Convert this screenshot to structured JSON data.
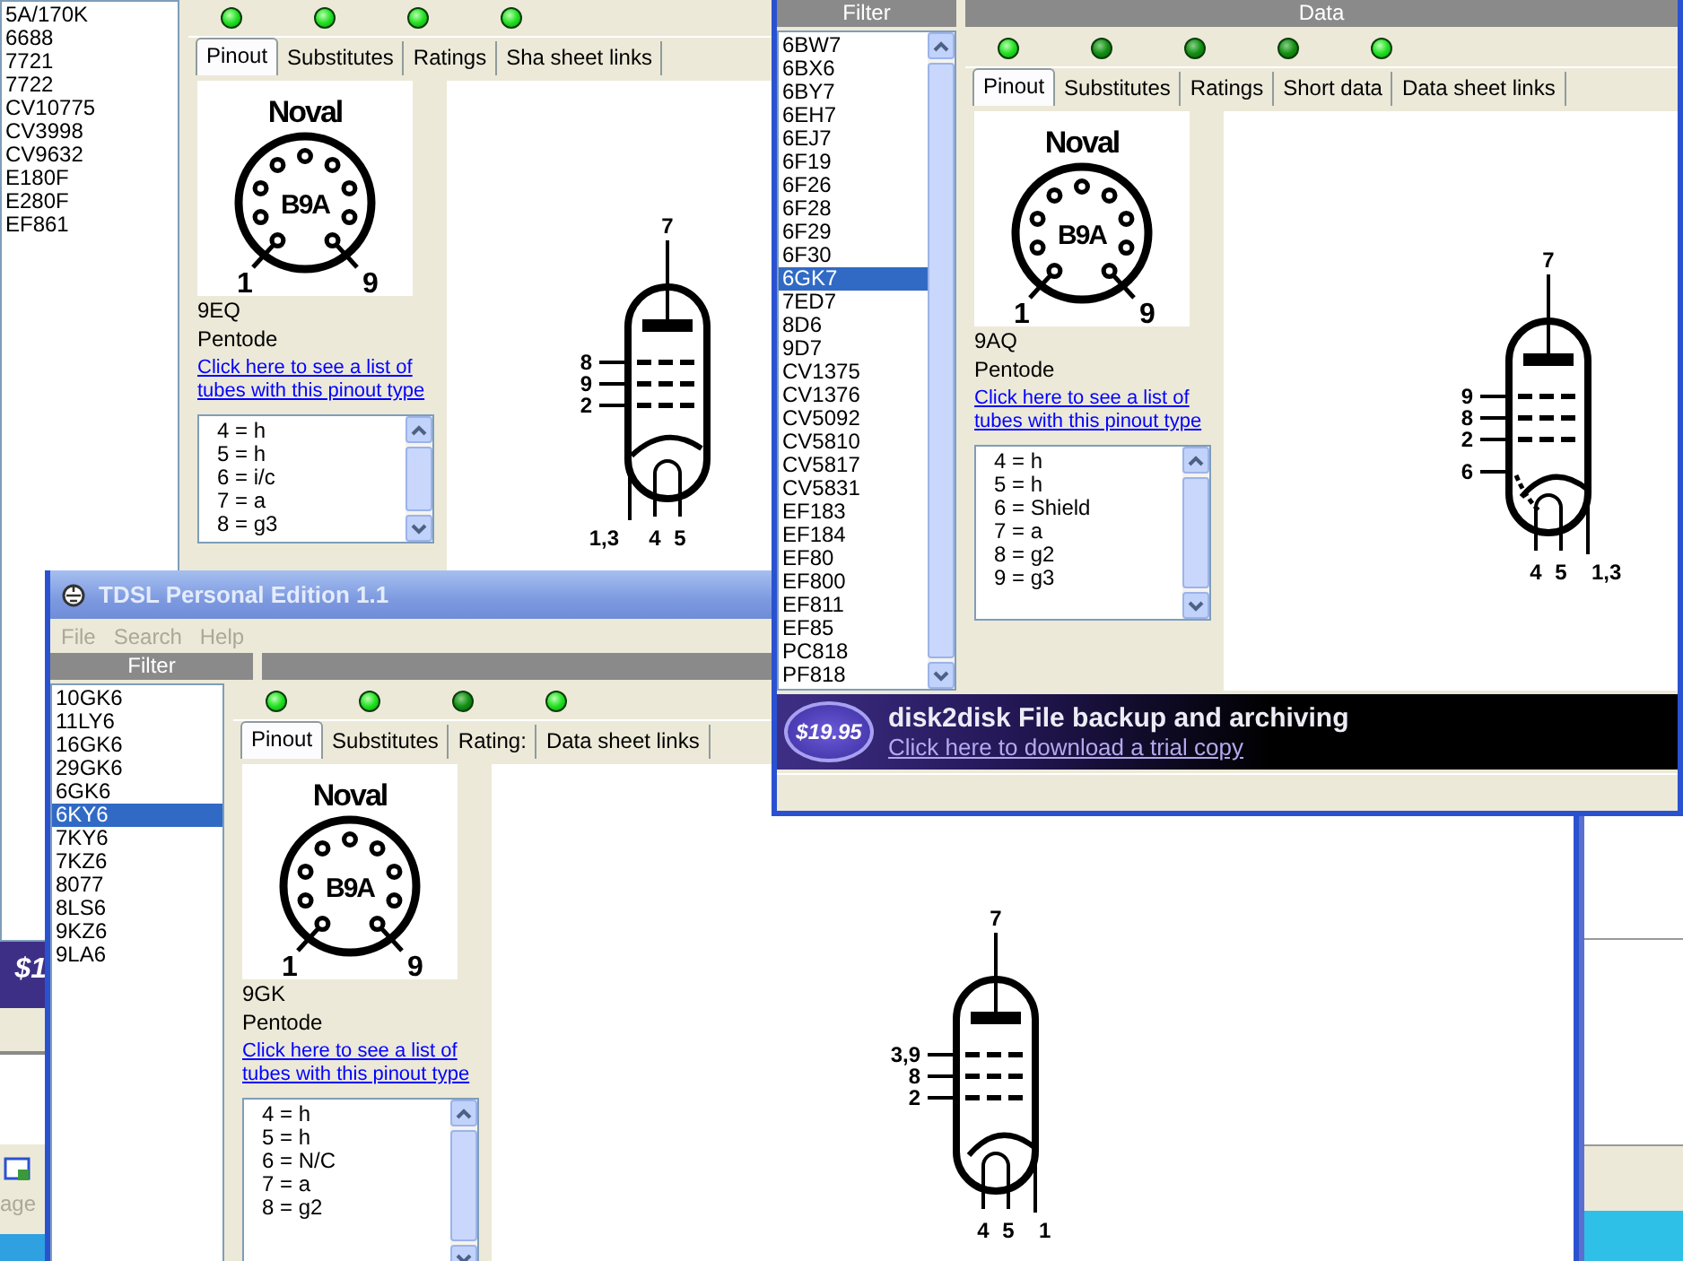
{
  "windows": [
    {
      "filter_list": [
        {
          "label": "5A/170K",
          "selected": false
        },
        {
          "label": "6688",
          "selected": false
        },
        {
          "label": "7721",
          "selected": false
        },
        {
          "label": "7722",
          "selected": false
        },
        {
          "label": "CV10775",
          "selected": false
        },
        {
          "label": "CV3998",
          "selected": false
        },
        {
          "label": "CV9632",
          "selected": false
        },
        {
          "label": "E180F",
          "selected": false
        },
        {
          "label": "E280F",
          "selected": false
        },
        {
          "label": "EF861",
          "selected": false
        }
      ],
      "leds": [
        {
          "lit": true
        },
        {
          "lit": true
        },
        {
          "lit": true
        },
        {
          "lit": true
        }
      ],
      "tabs": [
        {
          "label": "Pinout",
          "selected": true
        },
        {
          "label": "Substitutes",
          "selected": false
        },
        {
          "label": "Ratings",
          "selected": false
        },
        {
          "label": "Sha sheet links",
          "selected": false
        }
      ],
      "base": {
        "name": "Noval",
        "code": "B9A",
        "pin_first": "1",
        "pin_last": "9"
      },
      "pinout_code": "9EQ",
      "tube_type": "Pentode",
      "link": "Click here to see a list of tubes with this pinout type",
      "pins": [
        "4 = h",
        "5 = h",
        "6 = i/c",
        "7 = a",
        "8 = g3"
      ],
      "schematic": {
        "anode": "7",
        "grids": [
          "8",
          "9",
          "2"
        ],
        "bottom_pins": [
          {
            "label": "1,3",
            "kind": "cathode"
          },
          {
            "label": "4",
            "kind": "heater"
          },
          {
            "label": "5",
            "kind": "heater"
          }
        ]
      }
    },
    {
      "filter_header": "Filter",
      "data_header": "Data",
      "filter_list": [
        {
          "label": "6BW7",
          "selected": false
        },
        {
          "label": "6BX6",
          "selected": false
        },
        {
          "label": "6BY7",
          "selected": false
        },
        {
          "label": "6EH7",
          "selected": false
        },
        {
          "label": "6EJ7",
          "selected": false
        },
        {
          "label": "6F19",
          "selected": false
        },
        {
          "label": "6F26",
          "selected": false
        },
        {
          "label": "6F28",
          "selected": false
        },
        {
          "label": "6F29",
          "selected": false
        },
        {
          "label": "6F30",
          "selected": false
        },
        {
          "label": "6GK7",
          "selected": true
        },
        {
          "label": "7ED7",
          "selected": false
        },
        {
          "label": "8D6",
          "selected": false
        },
        {
          "label": "9D7",
          "selected": false
        },
        {
          "label": "CV1375",
          "selected": false
        },
        {
          "label": "CV1376",
          "selected": false
        },
        {
          "label": "CV5092",
          "selected": false
        },
        {
          "label": "CV5810",
          "selected": false
        },
        {
          "label": "CV5817",
          "selected": false
        },
        {
          "label": "CV5831",
          "selected": false
        },
        {
          "label": "EF183",
          "selected": false
        },
        {
          "label": "EF184",
          "selected": false
        },
        {
          "label": "EF80",
          "selected": false
        },
        {
          "label": "EF800",
          "selected": false
        },
        {
          "label": "EF811",
          "selected": false
        },
        {
          "label": "EF85",
          "selected": false
        },
        {
          "label": "PC818",
          "selected": false
        },
        {
          "label": "PF818",
          "selected": false
        }
      ],
      "leds": [
        {
          "lit": true
        },
        {
          "lit": false
        },
        {
          "lit": false
        },
        {
          "lit": false
        },
        {
          "lit": true
        }
      ],
      "tabs": [
        {
          "label": "Pinout",
          "selected": true
        },
        {
          "label": "Substitutes",
          "selected": false
        },
        {
          "label": "Ratings",
          "selected": false
        },
        {
          "label": "Short data",
          "selected": false
        },
        {
          "label": "Data sheet links",
          "selected": false
        }
      ],
      "base": {
        "name": "Noval",
        "code": "B9A",
        "pin_first": "1",
        "pin_last": "9"
      },
      "pinout_code": "9AQ",
      "tube_type": "Pentode",
      "link": "Click here to see a list of tubes with this pinout type",
      "pins": [
        "4 = h",
        "5 = h",
        "6 = Shield",
        "7 = a",
        "8 = g2",
        "9 = g3"
      ],
      "schematic": {
        "anode": "7",
        "grids": [
          "9",
          "8",
          "2"
        ],
        "shield": "6",
        "bottom_pins": [
          {
            "label": "4",
            "kind": "heater"
          },
          {
            "label": "5",
            "kind": "heater"
          },
          {
            "label": "1,3",
            "kind": "cathode"
          }
        ]
      },
      "banner": {
        "price": "$19.95",
        "headline": "disk2disk File backup and archiving",
        "link": "Click here to download a trial copy"
      }
    },
    {
      "title": "TDSL Personal Edition 1.1",
      "menu": [
        {
          "label": "File",
          "disabled": true
        },
        {
          "label": "Search",
          "disabled": true
        },
        {
          "label": "Help",
          "disabled": true
        }
      ],
      "filter_header": "Filter",
      "filter_list": [
        {
          "label": "10GK6",
          "selected": false
        },
        {
          "label": "11LY6",
          "selected": false
        },
        {
          "label": "16GK6",
          "selected": false
        },
        {
          "label": "29GK6",
          "selected": false
        },
        {
          "label": "6GK6",
          "selected": false
        },
        {
          "label": "6KY6",
          "selected": true
        },
        {
          "label": "7KY6",
          "selected": false
        },
        {
          "label": "7KZ6",
          "selected": false
        },
        {
          "label": "8077",
          "selected": false
        },
        {
          "label": "8LS6",
          "selected": false
        },
        {
          "label": "9KZ6",
          "selected": false
        },
        {
          "label": "9LA6",
          "selected": false
        }
      ],
      "leds": [
        {
          "lit": true
        },
        {
          "lit": true
        },
        {
          "lit": false
        },
        {
          "lit": true
        }
      ],
      "tabs": [
        {
          "label": "Pinout",
          "selected": true
        },
        {
          "label": "Substitutes",
          "selected": false
        },
        {
          "label": "Rating:",
          "selected": false
        },
        {
          "label": "Data sheet links",
          "selected": false
        }
      ],
      "base": {
        "name": "Noval",
        "code": "B9A",
        "pin_first": "1",
        "pin_last": "9"
      },
      "pinout_code": "9GK",
      "tube_type": "Pentode",
      "link": "Click here to see a list of tubes with this pinout type",
      "pins": [
        "4 = h",
        "5 = h",
        "6 = N/C",
        "7 = a",
        "8 = g2"
      ],
      "schematic": {
        "anode": "7",
        "grids": [
          "3,9",
          "8",
          "2"
        ],
        "bottom_pins": [
          {
            "label": "4",
            "kind": "heater"
          },
          {
            "label": "5",
            "kind": "heater"
          },
          {
            "label": "1",
            "kind": "cathode"
          }
        ]
      }
    }
  ],
  "background_window": {
    "ad_logo": "$1",
    "status_text": "age"
  }
}
